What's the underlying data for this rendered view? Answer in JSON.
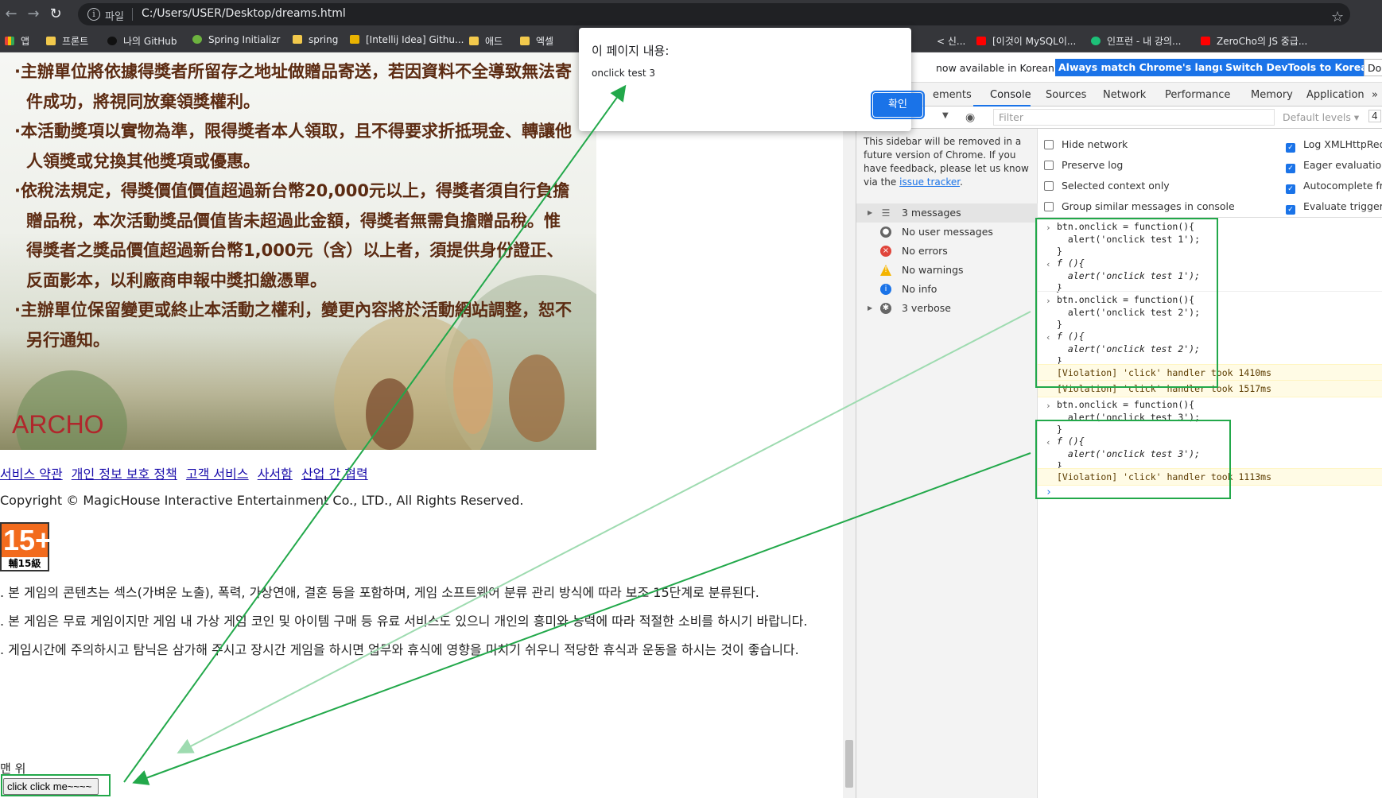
{
  "browser": {
    "scheme": "파일",
    "url": "C:/Users/USER/Desktop/dreams.html",
    "bookmarks": [
      "앱",
      "프론트",
      "나의 GitHub",
      "Spring Initializr",
      "spring",
      "[Intellij Idea] Githu...",
      "애드",
      "엑셀",
      "< 신...",
      "[이것이 MySQL이...",
      "인프런 - 내 강의...",
      "ZeroCho의 JS 중급..."
    ]
  },
  "page": {
    "hero_text": [
      "·主辦單位將依據得獎者所留存之地址做贈品寄送，若因資料不全導致無法寄件成功，將視同放棄領獎權利。",
      "·本活動獎項以實物為準，限得獎者本人領取，且不得要求折抵現金、轉讓他人領獎或兌換其他獎項或優惠。",
      "·依稅法規定，得獎價值價值超過新台幣20,000元以上，得獎者須自行負擔贈品稅，本次活動獎品價值皆未超過此金額，得獎者無需負擔贈品稅。惟得獎者之獎品價值超過新台幣1,000元（含）以上者，須提供身份證正、反面影本，以利廠商申報中獎扣繳憑單。",
      "·主辦單位保留變更或終止本活動之權利，變更內容將於活動網站調整，恕不另行通知。"
    ],
    "brand": "ARCHO",
    "footer_links": [
      "서비스 약관",
      "개인 정보 보호 정책",
      "고객 서비스",
      "사서함",
      "산업 간 협력"
    ],
    "copyright": "Copyright © MagicHouse Interactive Entertainment Co., LTD., All Rights Reserved.",
    "rating_top": "15+",
    "rating_bottom": "輔15級",
    "notes": [
      ". 본 게임의 콘텐츠는 섹스(가벼운 노출), 폭력, 가상연애, 결혼 등을 포함하며, 게임 소프트웨어 분류 관리 방식에 따라 보조 15단계로 분류된다.",
      ". 본 게임은 무료 게임이지만 게임 내 가상 게임 코인 및 아이템 구매 등 유료 서비스도 있으니 개인의 흥미와 능력에 따라 적절한 소비를 하시기 바랍니다.",
      ". 게임시간에 주의하시고 탐닉은 삼가해 주시고 장시간 게임을 하시면 업무와 휴식에 영향을 미치기 쉬우니 적당한 휴식과 운동을 하시는 것이 좋습니다."
    ],
    "top_link": "맨 위",
    "button_label": "click click me~~~~"
  },
  "alert": {
    "title": "이 페이지 내용:",
    "message": "onclick test 3",
    "ok": "확인"
  },
  "devtools": {
    "banner_text": "now available in Korean!",
    "banner_btn1": "Always match Chrome's language",
    "banner_btn2": "Switch DevTools to Korean",
    "banner_btn3": "Don",
    "tabs": [
      "ements",
      "Console",
      "Sources",
      "Network",
      "Performance",
      "Memory",
      "Application",
      "»"
    ],
    "filter_placeholder": "Filter",
    "levels": "Default levels ▾",
    "counter": "4",
    "sidebar_note_pre": "This sidebar will be removed in a future version of Chrome. If you have feedback, please let us know via the ",
    "sidebar_note_link": "issue tracker",
    "sidebar_note_post": ".",
    "sidebar_items": [
      "3 messages",
      "No user messages",
      "No errors",
      "No warnings",
      "No info",
      "3 verbose"
    ],
    "settings_left": [
      "Hide network",
      "Preserve log",
      "Selected context only",
      "Group similar messages in console"
    ],
    "settings_right": [
      "Log XMLHttpReq",
      "Eager evaluation",
      "Autocomplete fro",
      "Evaluate triggers"
    ],
    "console": {
      "entries": [
        {
          "input": [
            "btn.onclick = function(){",
            "  alert('onclick test 1');",
            "}"
          ],
          "output": [
            "f (){",
            "  alert('onclick test 1');",
            "}"
          ]
        },
        {
          "input": [
            "btn.onclick = function(){",
            "  alert('onclick test 2');",
            "}"
          ],
          "output": [
            "f (){",
            "  alert('onclick test 2');",
            "}"
          ]
        },
        {
          "input": [
            "btn.onclick = function(){",
            "  alert('onclick test 3');",
            "}"
          ],
          "output": [
            "f (){",
            "  alert('onclick test 3');",
            "}"
          ]
        }
      ],
      "violations": [
        "[Violation] 'click' handler took 1410ms",
        "[Violation] 'click' handler took 1517ms",
        "[Violation] 'click' handler took 1113ms"
      ]
    }
  },
  "colors": {
    "annotation": "#22a84a",
    "accent": "#1a73e8",
    "brand": "#b0272c"
  }
}
